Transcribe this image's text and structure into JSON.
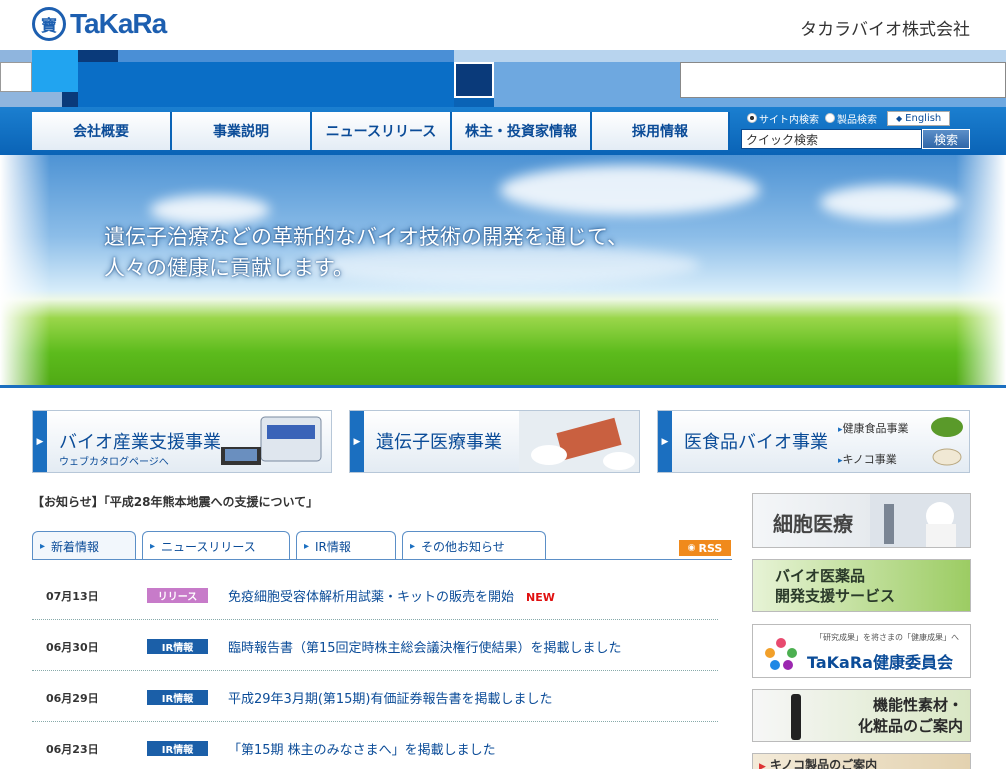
{
  "header": {
    "logo_mark": "寶",
    "logo_text": "TaKaRa",
    "company_name": "タカラバイオ株式会社"
  },
  "nav": {
    "items": [
      {
        "label": "会社概要"
      },
      {
        "label": "事業説明"
      },
      {
        "label": "ニュースリリース"
      },
      {
        "label": "株主・投資家情報"
      },
      {
        "label": "採用情報"
      }
    ]
  },
  "search": {
    "radio_site": "サイト内検索",
    "radio_product": "製品検索",
    "english_label": "English",
    "placeholder": "クイック検索",
    "button": "検索"
  },
  "hero": {
    "line1": "遺伝子治療などの革新的なバイオ技術の開発を通じて、",
    "line2": "人々の健康に貢献します。"
  },
  "business": [
    {
      "title": "バイオ産業支援事業",
      "sub": "ウェブカタログページへ"
    },
    {
      "title": "遺伝子医療事業"
    },
    {
      "title": "医食品バイオ事業",
      "links": [
        "健康食品事業",
        "キノコ事業"
      ]
    }
  ],
  "notice": "【お知らせ】「平成28年熊本地震への支援について」",
  "tabs": [
    {
      "label": "新着情報",
      "active": true
    },
    {
      "label": "ニュースリリース"
    },
    {
      "label": "IR情報"
    },
    {
      "label": "その他お知らせ"
    }
  ],
  "rss": "RSS",
  "news": [
    {
      "date": "07月13日",
      "badge": "リリース",
      "badge_color": "#c77bc9",
      "title": "免疫細胞受容体解析用試薬・キットの販売を開始",
      "new": "NEW"
    },
    {
      "date": "06月30日",
      "badge": "IR情報",
      "badge_color": "#1b5fa8",
      "title": "臨時報告書（第15回定時株主総会議決権行使結果）を掲載しました"
    },
    {
      "date": "06月29日",
      "badge": "IR情報",
      "badge_color": "#1b5fa8",
      "title": "平成29年3月期(第15期)有価証券報告書を掲載しました"
    },
    {
      "date": "06月23日",
      "badge": "IR情報",
      "badge_color": "#1b5fa8",
      "title": "「第15期 株主のみなさまへ」を掲載しました"
    }
  ],
  "side": {
    "cell": "細胞医療",
    "biopharma_1": "バイオ医薬品",
    "biopharma_2": "開発支援サービス",
    "committee_tag": "「研究成果」を将さまの「健康成果」へ",
    "committee": "TaKaRa健康委員会",
    "functional_1": "機能性素材・",
    "functional_2": "化粧品のご案内",
    "kinoko": "キノコ製品のご案内"
  },
  "colors": {
    "brand_blue": "#1d5fb0",
    "nav_blue": "#0a63b6",
    "rss_orange": "#f08a1c",
    "new_red": "#e01010"
  }
}
